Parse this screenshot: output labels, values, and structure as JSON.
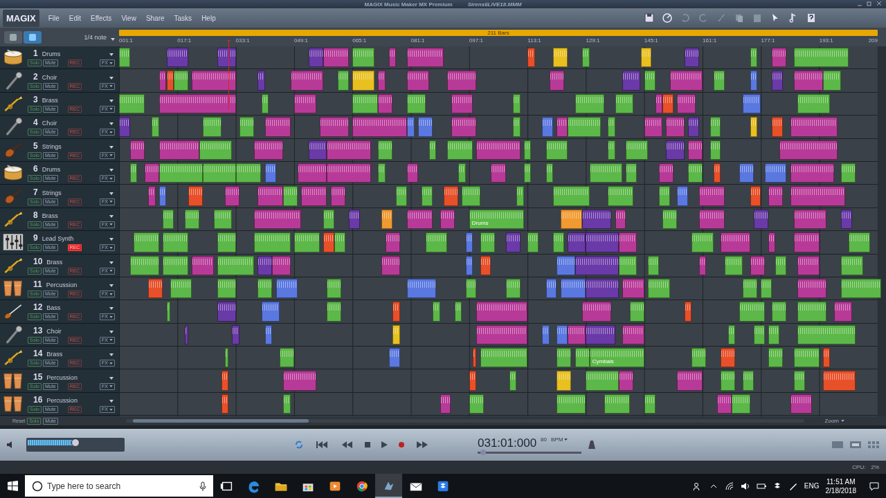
{
  "window": {
    "title": "MAGIX Music Maker MX Premium",
    "file": "Sirens6LIVE18.MMM"
  },
  "menu": {
    "logo": "MAGIX",
    "items": [
      "File",
      "Edit",
      "Effects",
      "View",
      "Share",
      "Tasks",
      "Help"
    ]
  },
  "view_modes": [
    {
      "selected": false
    },
    {
      "selected": true
    }
  ],
  "snap": "1/4 note",
  "range": {
    "label": "211 Bars"
  },
  "ruler": [
    "001:1",
    "017:1",
    "033:1",
    "049:1",
    "065:1",
    "081:1",
    "097:1",
    "113:1",
    "129:1",
    "145:1",
    "161:1",
    "177:1",
    "193:1",
    "209"
  ],
  "playhead": {
    "level": 0.144
  },
  "tracks": [
    {
      "number": "1",
      "name": "Drums",
      "kind": "drums",
      "solo": "Solo",
      "mute": "Mute",
      "rec": "REC",
      "fx": "FX",
      "rec_armed": false,
      "clips": [
        {
          "color": "#5cb848"
        },
        {
          "color": "#6a3aa8"
        },
        {
          "color": "#6a3aa8"
        },
        {
          "color": "#6a3aa8"
        },
        {
          "color": "#b83a98"
        },
        {
          "color": "#5cb848"
        },
        {
          "color": "#b83a98"
        },
        {
          "color": "#b83a98"
        },
        {
          "color": "#e8502a"
        },
        {
          "color": "#e8c020"
        },
        {
          "color": "#5cb848"
        },
        {
          "color": "#e8c020"
        },
        {
          "color": "#6a3aa8"
        },
        {
          "color": "#5cb848"
        },
        {
          "color": "#b83a98"
        },
        {
          "color": "#5cb848"
        }
      ]
    },
    {
      "number": "2",
      "name": "Choir",
      "kind": "mic",
      "solo": "Solo",
      "mute": "Mute",
      "rec": "REC",
      "fx": "FX",
      "rec_armed": false,
      "clips": [
        {
          "color": "#b83a98"
        },
        {
          "color": "#e8502a"
        },
        {
          "color": "#5cb848"
        },
        {
          "color": "#b83a98"
        },
        {
          "color": "#6a3aa8"
        },
        {
          "color": "#b83a98"
        },
        {
          "color": "#5cb848"
        },
        {
          "color": "#e8c020"
        },
        {
          "color": "#b83a98"
        },
        {
          "color": "#b83a98"
        },
        {
          "color": "#b83a98"
        },
        {
          "color": "#b83a98"
        },
        {
          "color": "#6a3aa8"
        },
        {
          "color": "#5cb848"
        },
        {
          "color": "#b83a98"
        },
        {
          "color": "#5cb848"
        },
        {
          "color": "#5a78e0"
        },
        {
          "color": "#6a3aa8"
        },
        {
          "color": "#b83a98"
        },
        {
          "color": "#5cb848"
        }
      ]
    },
    {
      "number": "3",
      "name": "Brass",
      "kind": "trumpet",
      "solo": "Solo",
      "mute": "Mute",
      "rec": "REC",
      "fx": "FX",
      "rec_armed": false,
      "clips": [
        {
          "color": "#5cb848"
        },
        {
          "color": "#b83a98"
        },
        {
          "color": "#5cb848"
        },
        {
          "color": "#b83a98"
        },
        {
          "color": "#5cb848"
        },
        {
          "color": "#b83a98"
        },
        {
          "color": "#5cb848"
        },
        {
          "color": "#b83a98"
        },
        {
          "color": "#5cb848"
        },
        {
          "color": "#5cb848"
        },
        {
          "color": "#5cb848"
        },
        {
          "color": "#b83a98"
        },
        {
          "color": "#e8502a"
        },
        {
          "color": "#b83a98"
        },
        {
          "color": "#5a78e0"
        },
        {
          "color": "#5cb848"
        }
      ]
    },
    {
      "number": "4",
      "name": "Choir",
      "kind": "mic",
      "solo": "Solo",
      "mute": "Mute",
      "rec": "REC",
      "fx": "FX",
      "rec_armed": false,
      "clips": [
        {
          "color": "#6a3aa8"
        },
        {
          "color": "#5cb848"
        },
        {
          "color": "#5cb848"
        },
        {
          "color": "#5cb848"
        },
        {
          "color": "#b83a98"
        },
        {
          "color": "#b83a98"
        },
        {
          "color": "#b83a98"
        },
        {
          "color": "#5a78e0"
        },
        {
          "color": "#5a78e0"
        },
        {
          "color": "#b83a98"
        },
        {
          "color": "#5cb848"
        },
        {
          "color": "#5a78e0"
        },
        {
          "color": "#b83a98"
        },
        {
          "color": "#5cb848"
        },
        {
          "color": "#5cb848"
        },
        {
          "color": "#b83a98"
        },
        {
          "color": "#b83a98"
        },
        {
          "color": "#6a3aa8"
        },
        {
          "color": "#5cb848"
        },
        {
          "color": "#e8c020"
        },
        {
          "color": "#e8502a"
        },
        {
          "color": "#b83a98"
        }
      ]
    },
    {
      "number": "5",
      "name": "Strings",
      "kind": "violin",
      "solo": "Solo",
      "mute": "Mute",
      "rec": "REC",
      "fx": "FX",
      "rec_armed": false,
      "clips": [
        {
          "color": "#b83a98"
        },
        {
          "color": "#b83a98"
        },
        {
          "color": "#5cb848"
        },
        {
          "color": "#b83a98"
        },
        {
          "color": "#6a3aa8"
        },
        {
          "color": "#b83a98"
        },
        {
          "color": "#5cb848"
        },
        {
          "color": "#5cb848"
        },
        {
          "color": "#5cb848"
        },
        {
          "color": "#b83a98"
        },
        {
          "color": "#5cb848"
        },
        {
          "color": "#5cb848"
        },
        {
          "color": "#5cb848"
        },
        {
          "color": "#5cb848"
        },
        {
          "color": "#6a3aa8"
        },
        {
          "color": "#b83a98"
        },
        {
          "color": "#5cb848"
        },
        {
          "color": "#b83a98"
        }
      ]
    },
    {
      "number": "6",
      "name": "Drums",
      "kind": "drums",
      "solo": "Solo",
      "mute": "Mute",
      "rec": "REC",
      "fx": "FX",
      "rec_armed": false,
      "clips": [
        {
          "color": "#5cb848"
        },
        {
          "color": "#b83a98"
        },
        {
          "color": "#5cb848"
        },
        {
          "color": "#5cb848"
        },
        {
          "color": "#5cb848"
        },
        {
          "color": "#5a78e0"
        },
        {
          "color": "#b83a98"
        },
        {
          "color": "#b83a98"
        },
        {
          "color": "#5cb848"
        },
        {
          "color": "#b83a98"
        },
        {
          "color": "#5cb848"
        },
        {
          "color": "#b83a98"
        },
        {
          "color": "#5cb848"
        },
        {
          "color": "#5cb848"
        },
        {
          "color": "#5cb848"
        },
        {
          "color": "#5cb848"
        },
        {
          "color": "#b83a98"
        },
        {
          "color": "#5cb848"
        },
        {
          "color": "#e8502a"
        },
        {
          "color": "#5a78e0"
        },
        {
          "color": "#5a78e0"
        },
        {
          "color": "#b83a98"
        },
        {
          "color": "#5cb848"
        }
      ]
    },
    {
      "number": "7",
      "name": "Strings",
      "kind": "violin",
      "solo": "Solo",
      "mute": "Mute",
      "rec": "REC",
      "fx": "FX",
      "rec_armed": false,
      "clips": [
        {
          "color": "#b83a98"
        },
        {
          "color": "#5a78e0"
        },
        {
          "color": "#e8502a"
        },
        {
          "color": "#b83a98"
        },
        {
          "color": "#b83a98"
        },
        {
          "color": "#5cb848"
        },
        {
          "color": "#b83a98"
        },
        {
          "color": "#b83a98"
        },
        {
          "color": "#5cb848"
        },
        {
          "color": "#5cb848"
        },
        {
          "color": "#e8502a"
        },
        {
          "color": "#5cb848"
        },
        {
          "color": "#5cb848"
        },
        {
          "color": "#5cb848"
        },
        {
          "color": "#5cb848"
        },
        {
          "color": "#5cb848"
        },
        {
          "color": "#5a78e0"
        },
        {
          "color": "#b83a98"
        },
        {
          "color": "#e8502a"
        },
        {
          "color": "#b83a98"
        },
        {
          "color": "#b83a98"
        }
      ]
    },
    {
      "number": "8",
      "name": "Brass",
      "kind": "trumpet",
      "solo": "Solo",
      "mute": "Mute",
      "rec": "REC",
      "fx": "FX",
      "rec_armed": false,
      "clips": [
        {
          "color": "#5cb848"
        },
        {
          "color": "#5cb848"
        },
        {
          "color": "#5cb848"
        },
        {
          "color": "#b83a98"
        },
        {
          "color": "#5cb848"
        },
        {
          "color": "#6a3aa8"
        },
        {
          "color": "#f09a30"
        },
        {
          "color": "#b83a98"
        },
        {
          "color": "#b83a98"
        },
        {
          "color": "#5cb848",
          "label": "Drums"
        },
        {
          "color": "#f09a30"
        },
        {
          "color": "#6a3aa8"
        },
        {
          "color": "#b83a98"
        },
        {
          "color": "#5cb848"
        },
        {
          "color": "#b83a98"
        },
        {
          "color": "#6a3aa8"
        },
        {
          "color": "#b83a98"
        },
        {
          "color": "#6a3aa8"
        }
      ]
    },
    {
      "number": "9",
      "name": "Lead Synth",
      "kind": "synth",
      "solo": "Solo",
      "mute": "Mute",
      "rec": "REC",
      "fx": "FX",
      "rec_armed": true,
      "clips": [
        {
          "color": "#5cb848"
        },
        {
          "color": "#5cb848"
        },
        {
          "color": "#5cb848"
        },
        {
          "color": "#5cb848"
        },
        {
          "color": "#5cb848"
        },
        {
          "color": "#e8502a"
        },
        {
          "color": "#5cb848"
        },
        {
          "color": "#b83a98"
        },
        {
          "color": "#5cb848"
        },
        {
          "color": "#5a78e0"
        },
        {
          "color": "#5cb848"
        },
        {
          "color": "#6a3aa8"
        },
        {
          "color": "#5cb848"
        },
        {
          "color": "#5cb848"
        },
        {
          "color": "#6a3aa8"
        },
        {
          "color": "#6a3aa8"
        },
        {
          "color": "#b83a98"
        },
        {
          "color": "#5cb848"
        },
        {
          "color": "#b83a98"
        },
        {
          "color": "#b83a98"
        },
        {
          "color": "#b83a98"
        },
        {
          "color": "#5cb848"
        }
      ]
    },
    {
      "number": "10",
      "name": "Brass",
      "kind": "trumpet",
      "solo": "Solo",
      "mute": "Mute",
      "rec": "REC",
      "fx": "FX",
      "rec_armed": false,
      "clips": [
        {
          "color": "#5cb848"
        },
        {
          "color": "#5cb848"
        },
        {
          "color": "#b83a98"
        },
        {
          "color": "#5cb848"
        },
        {
          "color": "#6a3aa8"
        },
        {
          "color": "#b83a98"
        },
        {
          "color": "#b83a98"
        },
        {
          "color": "#5a78e0"
        },
        {
          "color": "#e8502a"
        },
        {
          "color": "#5a78e0"
        },
        {
          "color": "#6a3aa8"
        },
        {
          "color": "#5cb848"
        },
        {
          "color": "#5cb848"
        },
        {
          "color": "#b83a98"
        },
        {
          "color": "#5cb848"
        },
        {
          "color": "#b83a98"
        },
        {
          "color": "#5cb848"
        },
        {
          "color": "#b83a98"
        },
        {
          "color": "#5cb848"
        }
      ]
    },
    {
      "number": "11",
      "name": "Percussion",
      "kind": "congas",
      "solo": "Solo",
      "mute": "Mute",
      "rec": "REC",
      "fx": "FX",
      "rec_armed": false,
      "clips": [
        {
          "color": "#e8502a"
        },
        {
          "color": "#5cb848"
        },
        {
          "color": "#5cb848"
        },
        {
          "color": "#5cb848"
        },
        {
          "color": "#5a78e0"
        },
        {
          "color": "#5cb848"
        },
        {
          "color": "#5a78e0"
        },
        {
          "color": "#5cb848"
        },
        {
          "color": "#5cb848"
        },
        {
          "color": "#5a78e0"
        },
        {
          "color": "#5a78e0"
        },
        {
          "color": "#6a3aa8"
        },
        {
          "color": "#b83a98"
        },
        {
          "color": "#5cb848"
        },
        {
          "color": "#5cb848"
        },
        {
          "color": "#5cb848"
        },
        {
          "color": "#b83a98"
        },
        {
          "color": "#5cb848"
        }
      ]
    },
    {
      "number": "12",
      "name": "Bass",
      "kind": "guitar",
      "solo": "Solo",
      "mute": "Mute",
      "rec": "REC",
      "fx": "FX",
      "rec_armed": false,
      "clips": [
        {
          "color": "#5cb848"
        },
        {
          "color": "#6a3aa8"
        },
        {
          "color": "#5a78e0"
        },
        {
          "color": "#5cb848"
        },
        {
          "color": "#e8502a"
        },
        {
          "color": "#5cb848"
        },
        {
          "color": "#5cb848"
        },
        {
          "color": "#b83a98"
        },
        {
          "color": "#b83a98"
        },
        {
          "color": "#5cb848"
        },
        {
          "color": "#e8502a"
        },
        {
          "color": "#5cb848"
        },
        {
          "color": "#5cb848"
        },
        {
          "color": "#5cb848"
        },
        {
          "color": "#b83a98"
        }
      ]
    },
    {
      "number": "13",
      "name": "Choir",
      "kind": "mic",
      "solo": "Solo",
      "mute": "Mute",
      "rec": "REC",
      "fx": "FX",
      "rec_armed": false,
      "clips": [
        {
          "color": "#6a3aa8"
        },
        {
          "color": "#6a3aa8"
        },
        {
          "color": "#5a78e0"
        },
        {
          "color": "#e8c020"
        },
        {
          "color": "#b83a98"
        },
        {
          "color": "#5a78e0"
        },
        {
          "color": "#5a78e0"
        },
        {
          "color": "#b83a98"
        },
        {
          "color": "#6a3aa8"
        },
        {
          "color": "#b83a98"
        },
        {
          "color": "#5cb848"
        },
        {
          "color": "#5cb848"
        },
        {
          "color": "#5cb848"
        },
        {
          "color": "#5cb848"
        }
      ]
    },
    {
      "number": "14",
      "name": "Brass",
      "kind": "trumpet",
      "solo": "Solo",
      "mute": "Mute",
      "rec": "REC",
      "fx": "FX",
      "rec_armed": false,
      "clips": [
        {
          "color": "#5cb848"
        },
        {
          "color": "#5cb848"
        },
        {
          "color": "#5a78e0"
        },
        {
          "color": "#e8502a"
        },
        {
          "color": "#5cb848"
        },
        {
          "color": "#5cb848"
        },
        {
          "color": "#5cb848"
        },
        {
          "color": "#5cb848",
          "label": "Cymbals"
        },
        {
          "color": "#5cb848"
        },
        {
          "color": "#e8502a"
        },
        {
          "color": "#5cb848"
        },
        {
          "color": "#5cb848"
        },
        {
          "color": "#e8502a"
        }
      ]
    },
    {
      "number": "15",
      "name": "Percussion",
      "kind": "congas",
      "solo": "Solo",
      "mute": "Mute",
      "rec": "REC",
      "fx": "FX",
      "rec_armed": false,
      "clips": [
        {
          "color": "#e8502a"
        },
        {
          "color": "#b83a98"
        },
        {
          "color": "#e8502a"
        },
        {
          "color": "#5cb848"
        },
        {
          "color": "#e8c020"
        },
        {
          "color": "#5cb848"
        },
        {
          "color": "#b83a98"
        },
        {
          "color": "#b83a98"
        },
        {
          "color": "#5cb848"
        },
        {
          "color": "#5cb848"
        },
        {
          "color": "#5cb848"
        },
        {
          "color": "#e8502a"
        }
      ]
    },
    {
      "number": "16",
      "name": "Percussion",
      "kind": "congas",
      "solo": "Solo",
      "mute": "Mute",
      "rec": "REC",
      "fx": "FX",
      "rec_armed": false,
      "clips": [
        {
          "color": "#e8502a"
        },
        {
          "color": "#5cb848"
        },
        {
          "color": "#b83a98"
        },
        {
          "color": "#5cb848"
        },
        {
          "color": "#5cb848"
        },
        {
          "color": "#5cb848"
        },
        {
          "color": "#5cb848"
        },
        {
          "color": "#b83a98"
        },
        {
          "color": "#5cb848"
        },
        {
          "color": "#b83a98"
        }
      ]
    }
  ],
  "footer": {
    "reset": "Reset",
    "solo": "Solo",
    "mute": "Mute",
    "zoom": "Zoom"
  },
  "transport": {
    "volume": {
      "level": 0.49
    },
    "time": "031:01:000",
    "tempo": "80",
    "tempo_unit": "BPM",
    "position": {
      "level": 0.05
    }
  },
  "status": {
    "cpu_label": "CPU:",
    "cpu": "2%"
  },
  "taskbar": {
    "search": {
      "placeholder": "Type here to search"
    },
    "apps": [
      {
        "kind": "taskview",
        "selected": false
      },
      {
        "kind": "edge",
        "selected": false
      },
      {
        "kind": "folder",
        "selected": false
      },
      {
        "kind": "store",
        "selected": false
      },
      {
        "kind": "media",
        "selected": false
      },
      {
        "kind": "chrome",
        "selected": false
      },
      {
        "kind": "magix",
        "selected": true
      },
      {
        "kind": "mail",
        "selected": false
      },
      {
        "kind": "dropbox",
        "selected": false
      }
    ],
    "language": "ENG",
    "time": "11:51 AM",
    "date": "2/18/2018"
  }
}
